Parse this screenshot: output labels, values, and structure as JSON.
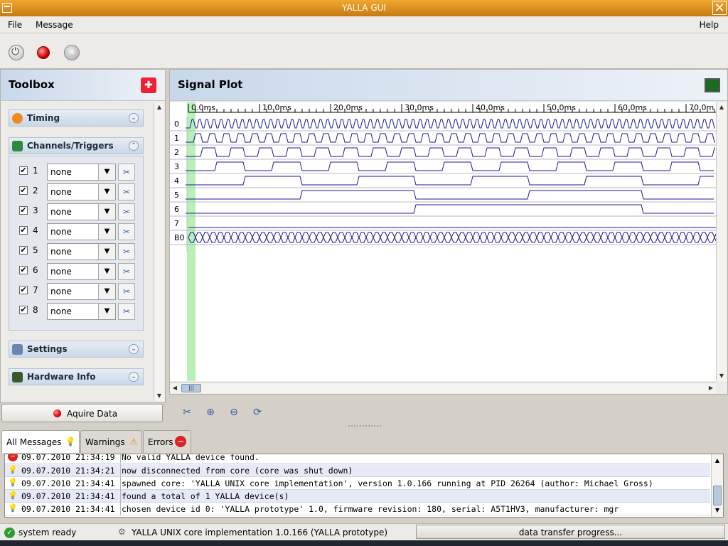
{
  "window": {
    "title": "YALLA GUI"
  },
  "menu": {
    "file": "File",
    "message": "Message",
    "help": "Help"
  },
  "toolbar": {
    "icons": [
      "power-icon",
      "record-icon",
      "stop-icon"
    ]
  },
  "toolbox": {
    "title": "Toolbox",
    "sections": {
      "timing": "Timing",
      "channels": "Channels/Triggers",
      "settings": "Settings",
      "hardware": "Hardware Info"
    },
    "channels": [
      {
        "num": "1",
        "checked": "✔",
        "trigger": "none"
      },
      {
        "num": "2",
        "checked": "✔",
        "trigger": "none"
      },
      {
        "num": "3",
        "checked": "✔",
        "trigger": "none"
      },
      {
        "num": "4",
        "checked": "✔",
        "trigger": "none"
      },
      {
        "num": "5",
        "checked": "✔",
        "trigger": "none"
      },
      {
        "num": "6",
        "checked": "✔",
        "trigger": "none"
      },
      {
        "num": "7",
        "checked": "✔",
        "trigger": "none"
      },
      {
        "num": "8",
        "checked": "✔",
        "trigger": "none"
      }
    ]
  },
  "acquire": {
    "label": "Aquire Data"
  },
  "plot": {
    "title": "Signal Plot",
    "time_labels": [
      "0.0ms",
      "10.0ms",
      "20.0ms",
      "30.0ms",
      "40.0ms",
      "50.0ms",
      "60.0ms",
      "70.0m"
    ],
    "rows": [
      "0",
      "1",
      "2",
      "3",
      "4",
      "5",
      "6",
      "7",
      "B0"
    ],
    "colors": {
      "signal": "#1a1a9a",
      "marker": "#b8f0b8"
    }
  },
  "messages": {
    "tabs": {
      "all": "All Messages",
      "warnings": "Warnings",
      "errors": "Errors"
    },
    "rows": [
      {
        "type": "error",
        "time": "09.07.2010 21:34:19",
        "text": "No valid YALLA device found."
      },
      {
        "type": "info",
        "time": "09.07.2010 21:34:21",
        "text": "now disconnected from core (core was shut down)"
      },
      {
        "type": "info",
        "time": "09.07.2010 21:34:41",
        "text": "spawned core: 'YALLA UNIX core implementation', version 1.0.166 running at PID 26264 (author: Michael Gross)"
      },
      {
        "type": "info",
        "time": "09.07.2010 21:34:41",
        "text": "found a total of 1 YALLA device(s)"
      },
      {
        "type": "info",
        "time": "09.07.2010 21:34:41",
        "text": "chosen device id 0: 'YALLA prototype' 1.0, firmware revision: 180, serial: A5T1HV3, manufacturer: mgr"
      }
    ]
  },
  "status": {
    "state": "system ready",
    "core": "YALLA UNIX core implementation 1.0.166 (YALLA prototype)",
    "transfer": "data transfer progress..."
  }
}
